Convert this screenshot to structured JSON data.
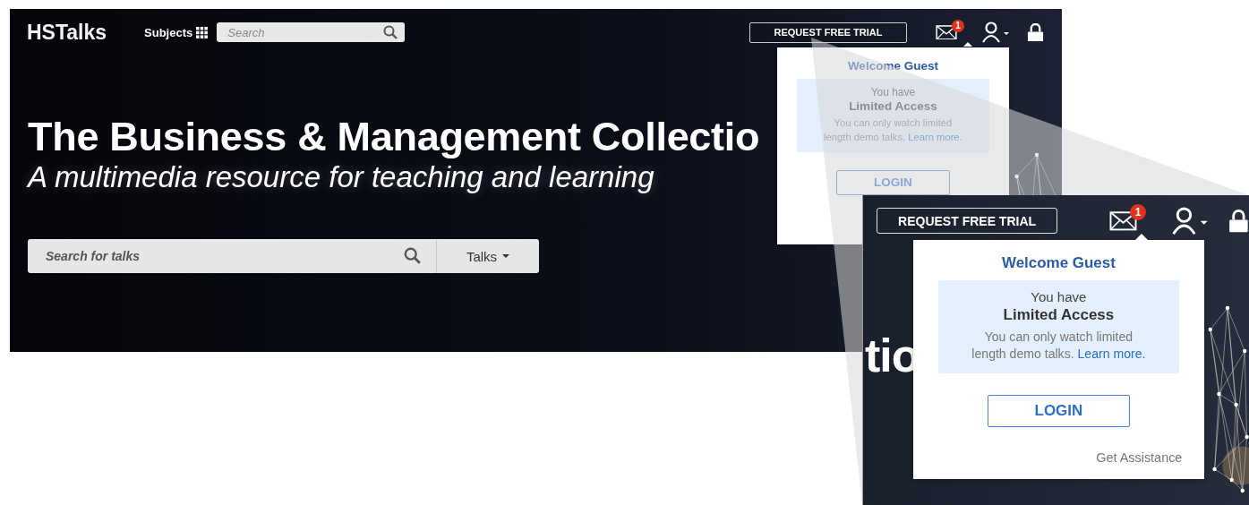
{
  "header": {
    "logo": "HSTalks",
    "subjects": "Subjects",
    "search_placeholder": "Search",
    "trial_button": "REQUEST FREE TRIAL",
    "mail_badge": "1"
  },
  "hero": {
    "title": "The Business & Management Collectio",
    "subtitle": "A multimedia resource for teaching and learning",
    "search_placeholder": "Search for talks",
    "filter": "Talks"
  },
  "account_menu": {
    "welcome": "Welcome",
    "name": "Guest",
    "notice_intro": "You have",
    "notice_level": "Limited Access",
    "notice_text": "You can only watch limited length demo talks.",
    "link": "Learn more.",
    "login": "LOGIN"
  },
  "zoom_inset": {
    "title_fragment": "tio",
    "trial_button": "REQUEST FREE TRIAL",
    "mail_badge": "1",
    "account_menu": {
      "welcome": "Welcome",
      "name": "Guest",
      "notice_intro": "You have",
      "notice_level": "Limited Access",
      "notice_text": "You can only watch limited length demo talks.",
      "link": "Learn more.",
      "login": "LOGIN",
      "assistance": "Get Assistance"
    }
  }
}
